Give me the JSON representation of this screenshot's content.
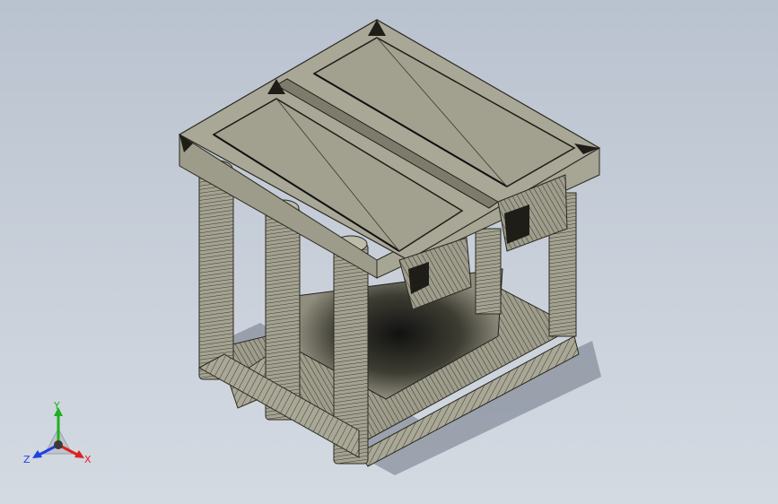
{
  "viewport": {
    "background_top": "#b9c2cf",
    "background_bottom": "#d4dae2",
    "model_face_color": "#a9a796",
    "model_dark_color": "#2b2a22",
    "shadow_color": "#6f7785"
  },
  "triad": {
    "x_label": "X",
    "y_label": "Y",
    "z_label": "Z",
    "x_color": "#e02020",
    "y_color": "#20b020",
    "z_color": "#2040e0"
  }
}
